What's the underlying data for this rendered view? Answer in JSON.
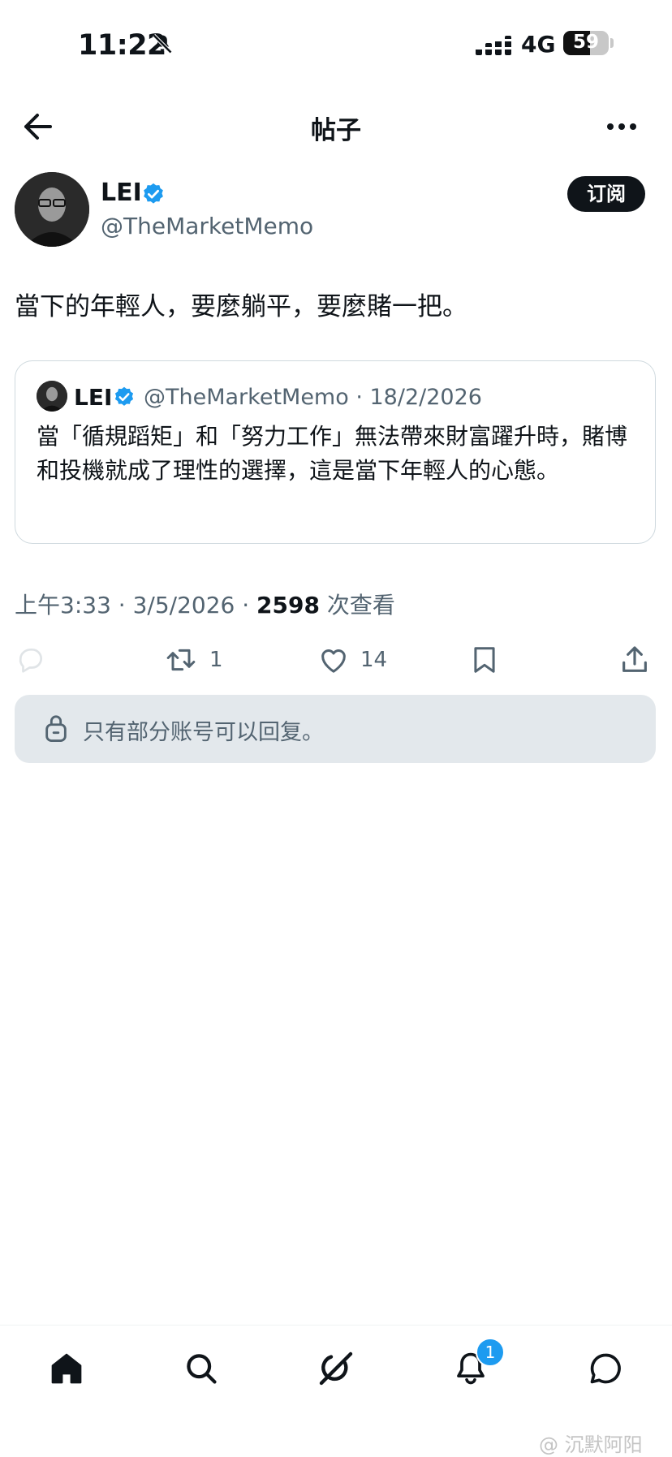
{
  "status_bar": {
    "time": "11:22",
    "network": "4G",
    "battery": "59",
    "battery_level": 0.59,
    "icons": [
      "bell-slash-icon",
      "signal-bars-icon"
    ]
  },
  "header": {
    "title": "帖子",
    "icons": [
      "back-arrow-icon",
      "more-horizontal-icon"
    ]
  },
  "author": {
    "name": "LEI",
    "handle": "@TheMarketMemo",
    "subscribe_label": "订阅",
    "verified_color": "#1d9bf0"
  },
  "post": {
    "text": "當下的年輕人，要麼躺平，要麼賭一把。"
  },
  "quote": {
    "name": "LEI",
    "handle_date": "@TheMarketMemo · 18/2/2026",
    "text": "當「循規蹈矩」和「努力工作」無法帶來財富躍升時，賭博和投機就成了理性的選擇，這是當下年輕人的心態。"
  },
  "meta": {
    "time_date": "上午3:33 · 3/5/2026 · ",
    "views": "2598",
    "views_suffix": " 次查看"
  },
  "actions": {
    "reply_count": "",
    "retweet_count": "1",
    "like_count": "14",
    "icons": [
      "reply-icon",
      "retweet-icon",
      "heart-icon",
      "bookmark-icon",
      "share-icon"
    ]
  },
  "reply_restriction": {
    "text": "只有部分账号可以回复。"
  },
  "bottom_nav": {
    "notification_badge": "1",
    "icons": [
      "home-icon",
      "search-icon",
      "grok-icon",
      "notifications-icon",
      "messages-icon"
    ]
  },
  "watermark": "@ 沉默阿阳",
  "colors": {
    "accent": "#1d9bf0",
    "text_primary": "#0f1419",
    "text_secondary": "#536471"
  }
}
